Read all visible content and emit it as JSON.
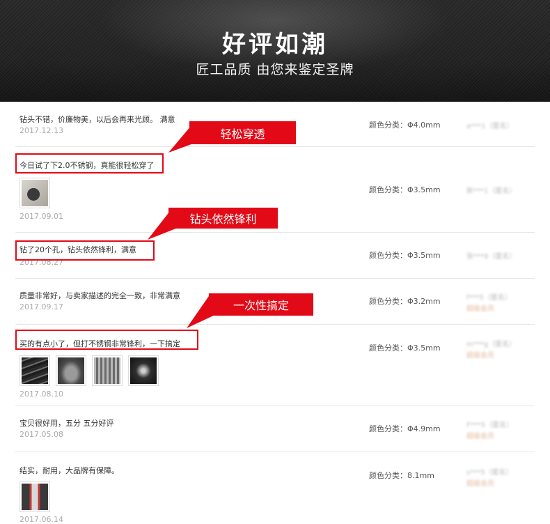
{
  "banner": {
    "title": "好评如潮",
    "subtitle": "匠工品质  由您来鉴定圣牌"
  },
  "reviews": [
    {
      "comment": "钻头不错，价廉物美，以后会再来光顾。 满意",
      "date": "2017.12.13",
      "color_spec": "颜色分类：Φ4.0mm",
      "user": "a***1（匿名）",
      "level": ""
    },
    {
      "comment": "今日试了下2.0不锈钢，真能很轻松穿了",
      "date": "2017.09.01",
      "color_spec": "颜色分类：Φ3.5mm",
      "user": "新***1（匿名）",
      "level": ""
    },
    {
      "comment": "钻了20个孔，钻头依然锋利，满意",
      "date": "2017.08.27",
      "color_spec": "颜色分类：Φ3.5mm",
      "user": "张***9（匿名）",
      "level": ""
    },
    {
      "comment": "质量非常好，与卖家描述的完全一致，非常满意",
      "date": "2017.09.17",
      "color_spec": "颜色分类：Φ3.2mm",
      "user": "f***5（匿名）",
      "level": "超级会员"
    },
    {
      "comment": "买的有点小了，但打不锈钢非常锋利，一下搞定",
      "date": "2017.08.10",
      "color_spec": "颜色分类：Φ3.5mm",
      "user": "m***g（匿名）",
      "level": "超级会员"
    },
    {
      "comment": "宝贝很好用，五分 五分好评",
      "date": "2017.05.08",
      "color_spec": "颜色分类：Φ4.9mm",
      "user": "F***5（匿名）",
      "level": "超级会员"
    },
    {
      "comment": "结实，耐用，大品牌有保障。",
      "date": "2017.06.14",
      "color_spec": "颜色分类：8.1mm",
      "user": "s***5（匿名）",
      "level": "超级会员"
    }
  ],
  "callouts": {
    "c1": "轻松穿透",
    "c2": "钻头依然锋利",
    "c3": "一次性搞定"
  },
  "colors": {
    "accent_red": "#e20a17",
    "banner_bg": "#232323"
  }
}
